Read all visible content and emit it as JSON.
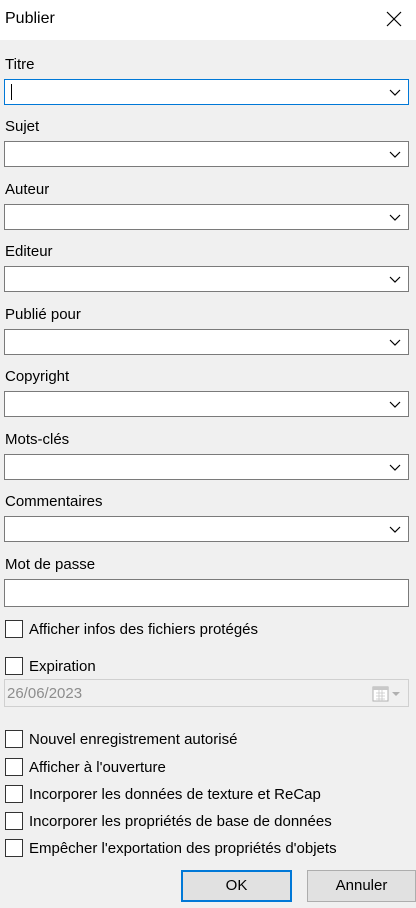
{
  "dialog": {
    "title": "Publier"
  },
  "fields": [
    {
      "label": "Titre",
      "value": ""
    },
    {
      "label": "Sujet",
      "value": ""
    },
    {
      "label": "Auteur",
      "value": ""
    },
    {
      "label": "Editeur",
      "value": ""
    },
    {
      "label": "Publié pour",
      "value": ""
    },
    {
      "label": "Copyright",
      "value": ""
    },
    {
      "label": "Mots-clés",
      "value": ""
    },
    {
      "label": "Commentaires",
      "value": ""
    }
  ],
  "password": {
    "label": "Mot de passe",
    "value": ""
  },
  "show_protected": {
    "label": "Afficher infos des fichiers protégés",
    "checked": false
  },
  "expiration": {
    "label": "Expiration",
    "checked": false,
    "date": "26/06/2023"
  },
  "options": [
    {
      "label": "Nouvel enregistrement autorisé",
      "checked": false
    },
    {
      "label": "Afficher à l'ouverture",
      "checked": false
    },
    {
      "label": "Incorporer les données de texture et ReCap",
      "checked": false
    },
    {
      "label": "Incorporer les propriétés de base de données",
      "checked": false
    },
    {
      "label": "Empêcher l'exportation des propriétés d'objets",
      "checked": false
    }
  ],
  "buttons": {
    "ok": "OK",
    "cancel": "Annuler"
  },
  "colors": {
    "accent": "#0078d7",
    "background": "#f0f0f0",
    "disabled_text": "#8d8d8d"
  }
}
